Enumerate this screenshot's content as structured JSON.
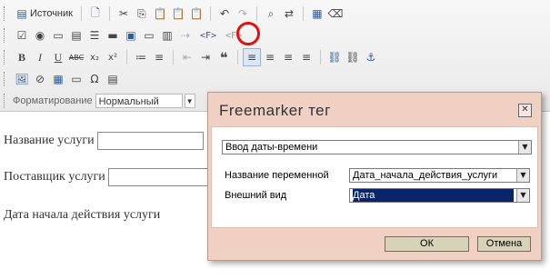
{
  "toolbar": {
    "source_label": "Источник",
    "format_label": "Форматирование",
    "format_value": "Нормальный"
  },
  "document": {
    "line1": "Название услуги",
    "line2": "Поставщик услуги",
    "line3": "Дата начала действия услуги"
  },
  "dialog": {
    "title": "Freemarker тег",
    "close": "✕",
    "type_value": "Ввод даты-времени",
    "var_label": "Название переменной",
    "var_value": "Дата_начала_действия_услуги",
    "view_label": "Внешний вид",
    "view_value": "Дата",
    "ok_label": "ОК",
    "cancel_label": "Отмена"
  }
}
